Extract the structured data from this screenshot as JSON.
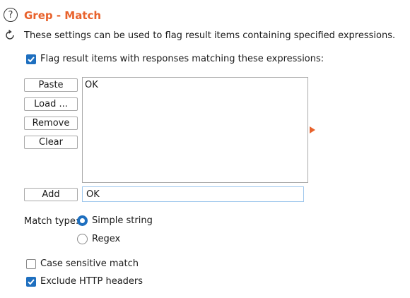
{
  "header": {
    "title": "Grep - Match",
    "description": "These settings can be used to flag result items containing specified expressions."
  },
  "flag_checkbox": {
    "label": "Flag result items with responses matching these expressions:",
    "checked": true
  },
  "buttons": {
    "paste": "Paste",
    "load": "Load ...",
    "remove": "Remove",
    "clear": "Clear",
    "add": "Add"
  },
  "expressions": [
    "OK"
  ],
  "input": {
    "value": "OK"
  },
  "match_type": {
    "label": "Match type:",
    "options": [
      {
        "label": "Simple string",
        "selected": true
      },
      {
        "label": "Regex",
        "selected": false
      }
    ]
  },
  "options": {
    "case_sensitive": {
      "label": "Case sensitive match",
      "checked": false
    },
    "exclude_headers": {
      "label": "Exclude HTTP headers",
      "checked": true
    }
  },
  "colors": {
    "accent": "#e8622c",
    "primary": "#1e6fbf"
  },
  "icons": {
    "help": "help-icon",
    "refresh": "refresh-icon",
    "arrow": "expand-arrow-icon"
  }
}
